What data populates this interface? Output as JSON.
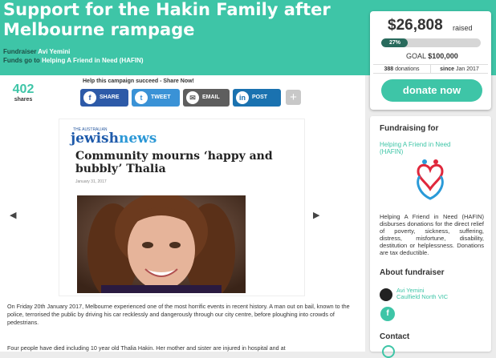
{
  "header": {
    "title": "Support for the Hakin Family after Melbourne rampage",
    "fundraiser_label": "Fundraiser",
    "fundraiser_name": "Avi Yemini",
    "funds_label": "Funds go to",
    "funds_name": "Helping A Friend in Need (HAFIN)"
  },
  "raised": {
    "amount": "$26,808",
    "raised_label": "raised",
    "progress_pct": "27%",
    "progress_value": 0.27,
    "goal_label": "GOAL",
    "goal_amount": "$100,000",
    "donations_count": "388",
    "donations_label": "donations",
    "since_label": "since",
    "since_value": "Jan 2017",
    "donate_label": "donate now"
  },
  "share": {
    "count": "402",
    "count_label": "shares",
    "help_text": "Help this campaign succeed - Share Now!",
    "buttons": [
      {
        "label": "SHARE",
        "icon": "facebook-icon",
        "glyph": "f"
      },
      {
        "label": "TWEET",
        "icon": "twitter-icon",
        "glyph": "t"
      },
      {
        "label": "EMAIL",
        "icon": "email-icon",
        "glyph": "✉"
      },
      {
        "label": "POST",
        "icon": "linkedin-icon",
        "glyph": "in"
      }
    ],
    "more": "+"
  },
  "article": {
    "paper_small": "THE AUSTRALIAN",
    "paper_name_a": "jewish",
    "paper_name_b": "news",
    "headline": "Community mourns ‘happy and bubbly’ Thalia",
    "date": "January 31, 2017",
    "prev": "◀",
    "next": "▶"
  },
  "body": {
    "p1": "On Friday 20th January 2017, Melbourne experienced one of the most horrific events in recent history. A man out on bail, known to the police, terrorised the public by driving his car recklessly and dangerously through our city centre, before ploughing into crowds of pedestrians.",
    "p2": "Four people have died including 10 year old Thalia Hakin. Her mother and sister are injured in hospital and at"
  },
  "sidebar": {
    "fundraising_for": "Fundraising for",
    "org_name": "Helping A Friend in Need (HAFIN)",
    "org_desc": "Helping A Friend in Need (HAFIN) disburses donations for the direct relief of poverty, sickness, suffering, distress, misfortune, disability, destitution or helplessness. Donations are tax deductible.",
    "about_fundraiser": "About fundraiser",
    "fundraiser_name": "Avi Yemini",
    "fundraiser_location": "Caulfield North VIC",
    "fb_glyph": "f",
    "contact": "Contact"
  },
  "colors": {
    "brand": "#3ec5a7",
    "progress": "#286a5c",
    "facebook": "#2d5aa8",
    "twitter": "#3a92d6",
    "email": "#5e5e5e",
    "linkedin": "#1a72b0"
  }
}
